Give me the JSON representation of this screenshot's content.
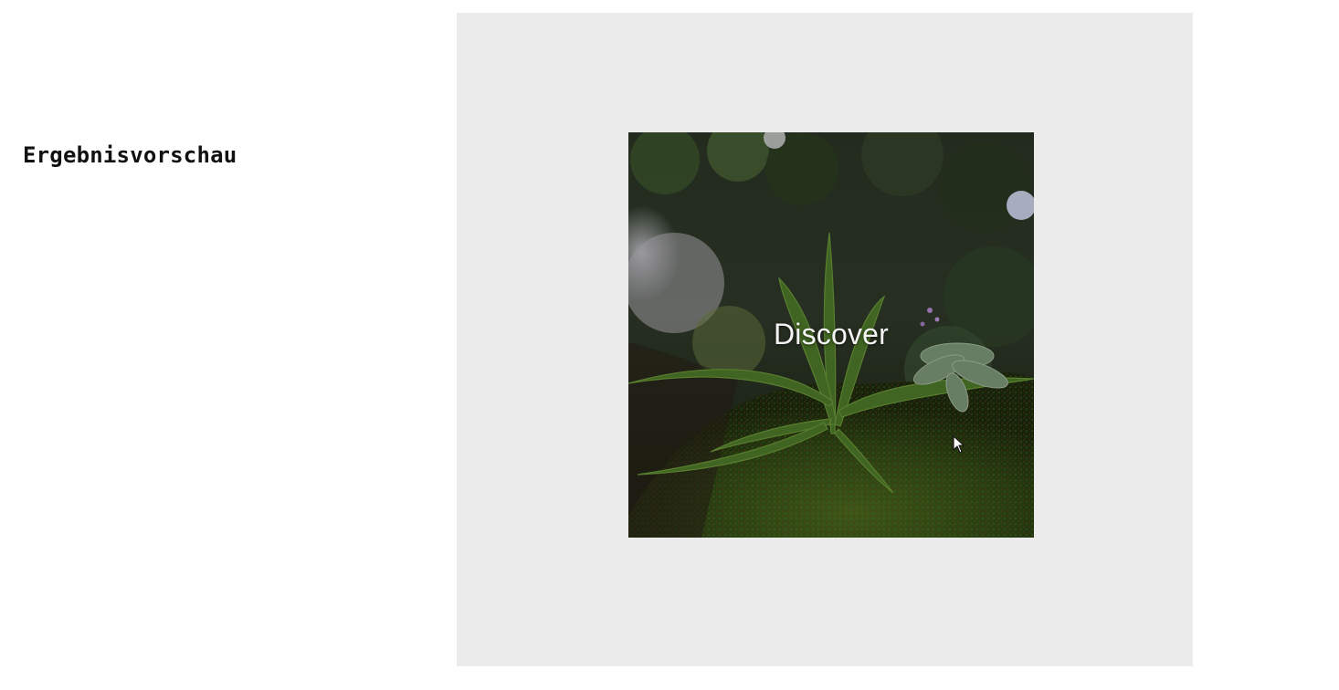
{
  "page": {
    "title": "Ergebnisvorschau"
  },
  "preview": {
    "card_label": "Discover",
    "image_subject": "plant-on-moss-photo",
    "cursor_icon": "arrow-cursor"
  },
  "colors": {
    "panel_background": "#ebebeb",
    "page_background": "#ffffff",
    "label_text": "#f4f4f4"
  }
}
